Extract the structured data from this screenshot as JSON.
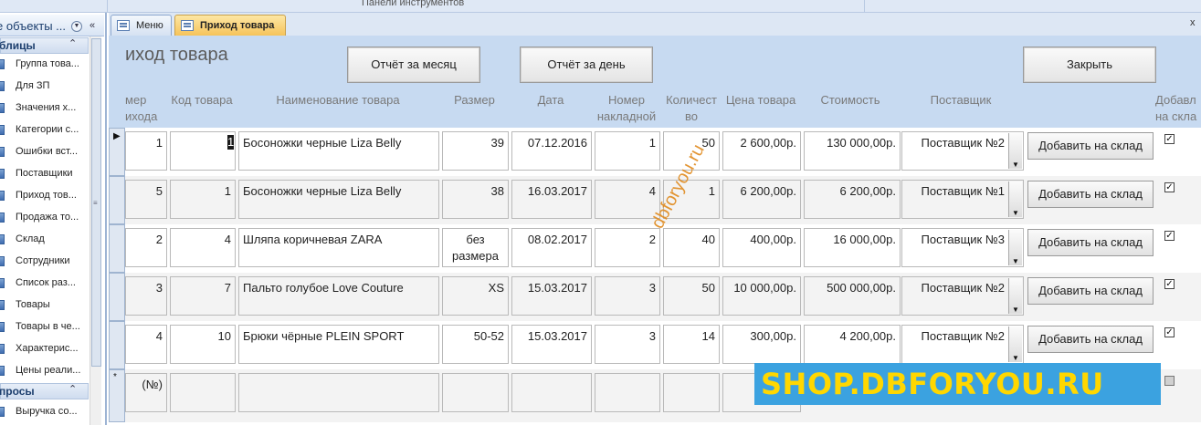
{
  "ribbon": {
    "label": "Панели инструментов"
  },
  "nav": {
    "title": "е объекты ...",
    "groups": [
      {
        "label": "блицы",
        "items": [
          "Группа това...",
          "Для ЗП",
          "Значения х...",
          "Категории с...",
          "Ошибки вст...",
          "Поставщики",
          "Приход тов...",
          "Продажа то...",
          "Склад",
          "Сотрудники",
          "Список раз...",
          "Товары",
          "Товары в че...",
          "Характерис...",
          "Цены реали..."
        ]
      },
      {
        "label": "просы",
        "items": [
          "Выручка со..."
        ]
      }
    ],
    "chevron": "«",
    "group_chevron": "⌃"
  },
  "tabs": [
    {
      "label": "Меню",
      "active": false
    },
    {
      "label": "Приход товара",
      "active": true
    }
  ],
  "tab_close": "x",
  "form": {
    "title": "иход товара",
    "buttons": {
      "month_report": "Отчёт за месяц",
      "day_report": "Отчёт за день",
      "close": "Закрыть"
    },
    "columns": [
      "мер\nихода",
      "Код товара",
      "Наименование товара",
      "Размер",
      "Дата",
      "Номер\nнакладной",
      "Количест\nво",
      "Цена товара",
      "Стоимость",
      "Поставщик",
      "Добавл\nна скла"
    ],
    "add_button_label": "Добавить на склад",
    "rows": [
      {
        "num": "1",
        "code": "1",
        "name": "Босоножки черные Liza Belly",
        "size": "39",
        "date": "07.12.2016",
        "invoice": "1",
        "qty": "50",
        "price": "2 600,00р.",
        "cost": "130 000,00р.",
        "supplier": "Поставщик №2",
        "added": true
      },
      {
        "num": "5",
        "code": "1",
        "name": "Босоножки черные Liza Belly",
        "size": "38",
        "date": "16.03.2017",
        "invoice": "4",
        "qty": "1",
        "price": "6 200,00р.",
        "cost": "6 200,00р.",
        "supplier": "Поставщик №1",
        "added": true
      },
      {
        "num": "2",
        "code": "4",
        "name": "Шляпа коричневая ZARA",
        "size": "без\nразмера",
        "date": "08.02.2017",
        "invoice": "2",
        "qty": "40",
        "price": "400,00р.",
        "cost": "16 000,00р.",
        "supplier": "Поставщик №3",
        "added": true
      },
      {
        "num": "3",
        "code": "7",
        "name": "Пальто голубое Love Couture",
        "size": "XS",
        "date": "15.03.2017",
        "invoice": "3",
        "qty": "50",
        "price": "10 000,00р.",
        "cost": "500 000,00р.",
        "supplier": "Поставщик №2",
        "added": true
      },
      {
        "num": "4",
        "code": "10",
        "name": "Брюки чёрные PLEIN SPORT",
        "size": "50-52",
        "date": "15.03.2017",
        "invoice": "3",
        "qty": "14",
        "price": "300,00р.",
        "cost": "4 200,00р.",
        "supplier": "Поставщик №2",
        "added": true
      }
    ],
    "new_row": {
      "num": "(№)",
      "marker": "*"
    },
    "current_marker": "▶",
    "check_mark": "✓"
  },
  "watermarks": {
    "diagonal": "dbforyou.ru",
    "banner": "SHOP.DBFORYOU.RU"
  },
  "colors": {
    "header_bg": "#c7daf1",
    "active_tab": "#f6c35a",
    "banner_bg": "#3ba2e0",
    "banner_text": "#ffd700",
    "diag_text": "#e08a1e"
  }
}
